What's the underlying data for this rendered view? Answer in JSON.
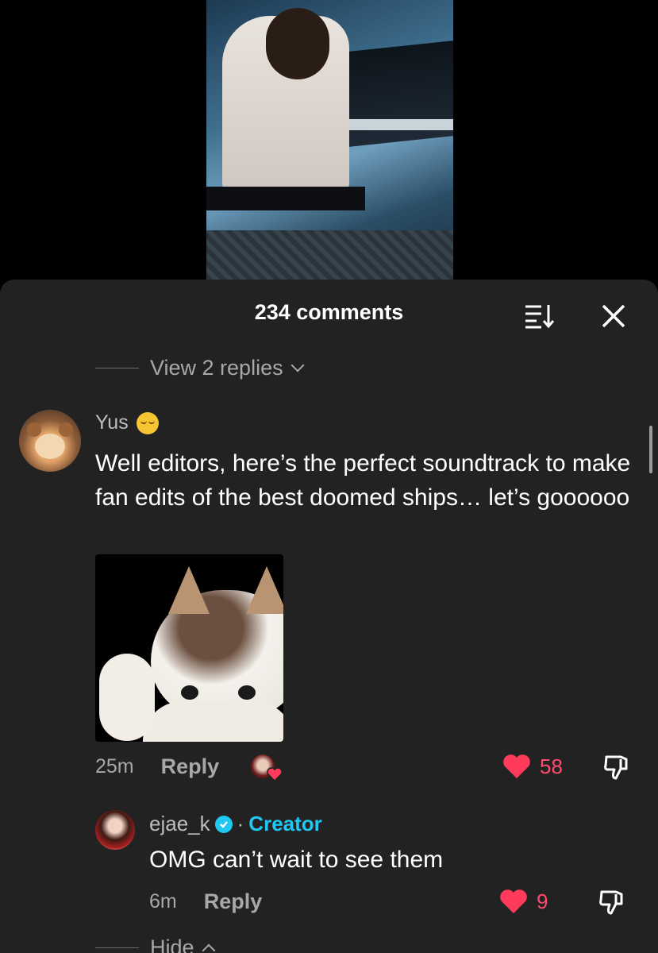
{
  "sheet": {
    "title": "234 comments"
  },
  "thread": {
    "view_replies": "View 2 replies"
  },
  "comment1": {
    "username": "Yus",
    "text": "Well editors, here’s the perfect soundtrack to make fan edits of the best doomed ships… let’s goooooo",
    "time": "25m",
    "reply_label": "Reply",
    "likes": "58"
  },
  "comment2": {
    "username": "ejae_k",
    "separator": "·",
    "badge": "Creator",
    "text": "OMG can’t wait to see them",
    "time": "6m",
    "reply_label": "Reply",
    "likes": "9"
  },
  "hide_label": "Hide",
  "colors": {
    "accent_like": "#ff3b5c",
    "creator_blue": "#20c7f0",
    "sheet_bg": "#222222"
  }
}
